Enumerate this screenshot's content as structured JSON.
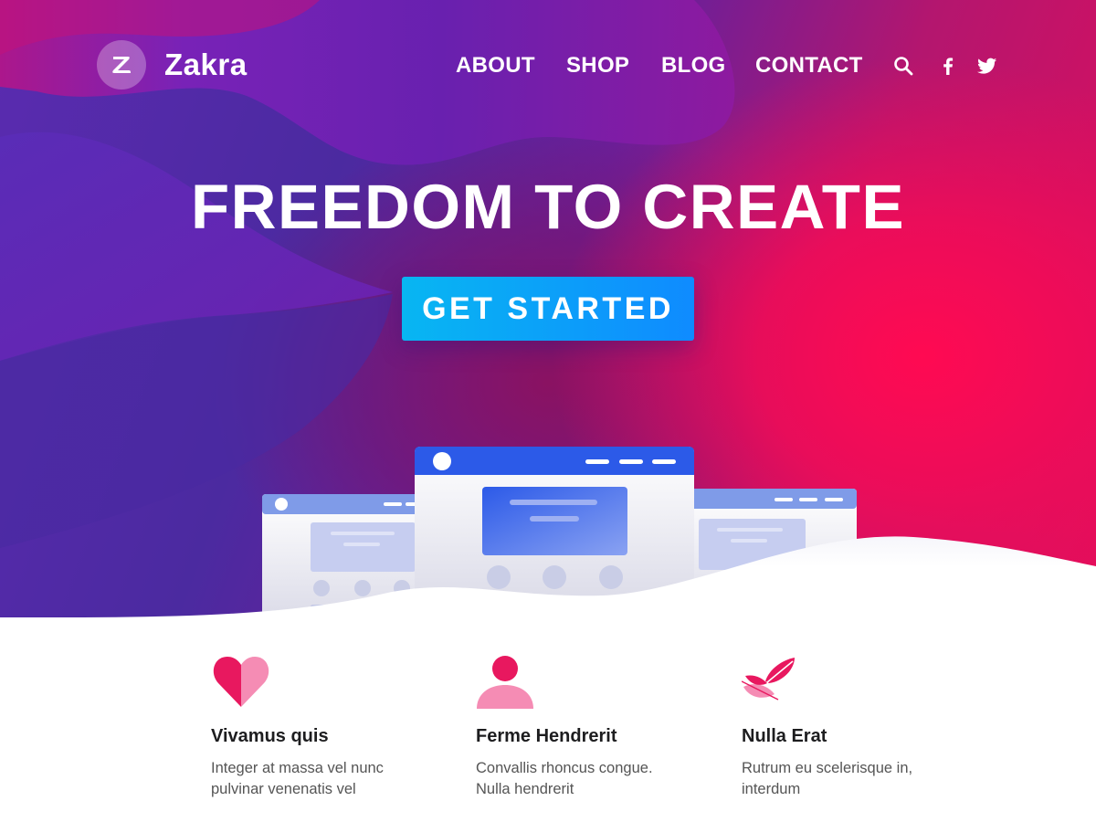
{
  "brand": {
    "logo_text": "Zakra",
    "logo_icon": "z-logo-icon"
  },
  "nav": {
    "items": [
      {
        "label": "ABOUT"
      },
      {
        "label": "SHOP"
      },
      {
        "label": "BLOG"
      },
      {
        "label": "CONTACT"
      }
    ],
    "icons": [
      "search-icon",
      "facebook-icon",
      "twitter-icon"
    ]
  },
  "hero": {
    "headline": "FREEDOM TO CREATE",
    "cta_label": "GET STARTED"
  },
  "features": [
    {
      "icon": "heart-icon",
      "title": "Vivamus quis",
      "line1": "Integer at massa vel nunc",
      "line2": "pulvinar venenatis vel"
    },
    {
      "icon": "user-icon",
      "title": "Ferme Hendrerit",
      "line1": "Convallis rhoncus congue.",
      "line2": "Nulla hendrerit"
    },
    {
      "icon": "feather-icon",
      "title": "Nulla Erat",
      "line1": "Rutrum eu scelerisque in,",
      "line2": "interdum"
    }
  ],
  "colors": {
    "accent_pink": "#e8185f",
    "accent_blue": "#0f8bff",
    "hero_purple": "#4b2aa0",
    "hero_red": "#ff0a52"
  }
}
